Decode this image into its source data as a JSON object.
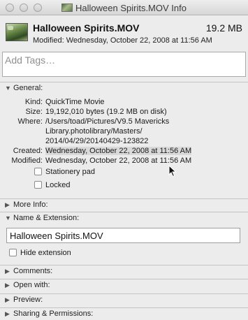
{
  "window": {
    "title": "Halloween Spirits.MOV Info"
  },
  "header": {
    "file_name": "Halloween Spirits.MOV",
    "file_size": "19.2 MB",
    "modified": "Modified: Wednesday, October 22, 2008 at 11:56 AM"
  },
  "tags": {
    "placeholder": "Add Tags…"
  },
  "general": {
    "label": "General:",
    "rows": {
      "kind": {
        "label": "Kind:",
        "value": "QuickTime Movie"
      },
      "size": {
        "label": "Size:",
        "value": "19,192,010 bytes (19.2 MB on disk)"
      },
      "where": {
        "label": "Where:",
        "line1": "/Users/toad/Pictures/V9.5 Mavericks",
        "line2": "Library.photolibrary/Masters/",
        "line3": "2014/04/29/20140429-123822"
      },
      "created": {
        "label": "Created:",
        "value": "Wednesday, October 22, 2008 at 11:56 AM"
      },
      "modified": {
        "label": "Modified:",
        "value": "Wednesday, October 22, 2008 at 11:56 AM"
      }
    },
    "stationery_pad": "Stationery pad",
    "locked": "Locked"
  },
  "more_info": {
    "label": "More Info:"
  },
  "name_extension": {
    "label": "Name & Extension:",
    "value": "Halloween Spirits.MOV",
    "hide_extension": "Hide extension"
  },
  "comments": {
    "label": "Comments:"
  },
  "open_with": {
    "label": "Open with:"
  },
  "preview": {
    "label": "Preview:"
  },
  "sharing": {
    "label": "Sharing & Permissions:"
  }
}
